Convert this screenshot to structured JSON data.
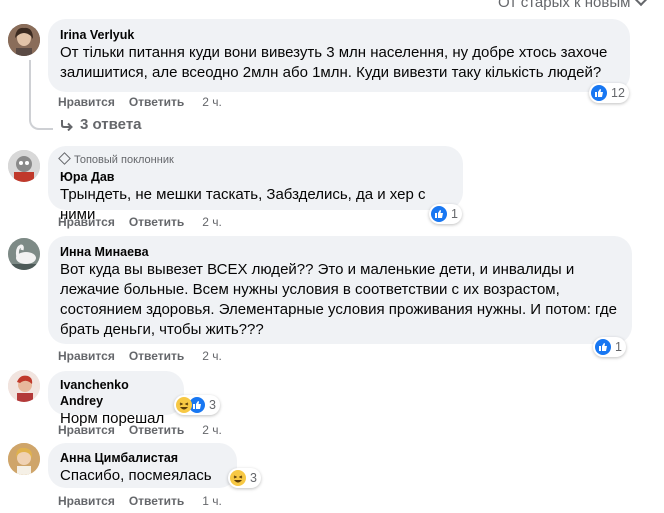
{
  "sort_label": "От старых к новым",
  "colors": {
    "bubble": "#f0f2f5",
    "meta": "#65676b",
    "like": "#1877f2",
    "haha": "#f7c844"
  },
  "comments": [
    {
      "author": "Irina Verlyuk",
      "text": "От тільки питання куди вони вивезуть 3 млн населення, ну добре хтось захоче залишитися, але всеодно 2млн або 1млн. Куди вивезти таку кількість людей?",
      "like_label": "Нравится",
      "reply_label": "Ответить",
      "time": "2 ч.",
      "reaction_count": "12",
      "reactions": [
        "like-icon"
      ],
      "replies_label": "3 ответа"
    },
    {
      "badge": "Топовый поклонник",
      "author": "Юра Дав",
      "text": "Трындеть, не мешки таскать, Забзделись, да и хер с ними",
      "like_label": "Нравится",
      "reply_label": "Ответить",
      "time": "2 ч.",
      "reaction_count": "1",
      "reactions": [
        "like-icon"
      ]
    },
    {
      "author": "Инна Минаева",
      "text": "Вот куда вы вывезет ВСЕХ людей?? Это и маленькие дети, и инвалиды и лежачие больные. Всем нужны условия в соответствии с их возрастом, состоянием здоровья. Элементарные условия проживания нужны. И потом: где брать деньги, чтобы жить???",
      "like_label": "Нравится",
      "reply_label": "Ответить",
      "time": "2 ч.",
      "reaction_count": "1",
      "reactions": [
        "like-icon"
      ]
    },
    {
      "author": "Ivanchenko Andrey",
      "text": "Норм порешал",
      "like_label": "Нравится",
      "reply_label": "Ответить",
      "time": "2 ч.",
      "reaction_count": "3",
      "reactions": [
        "haha-icon",
        "like-icon"
      ]
    },
    {
      "author": "Анна Цимбалистая",
      "text": "Спасибо, посмеялась",
      "like_label": "Нравится",
      "reply_label": "Ответить",
      "time": "1 ч.",
      "reaction_count": "3",
      "reactions": [
        "haha-icon"
      ]
    }
  ]
}
